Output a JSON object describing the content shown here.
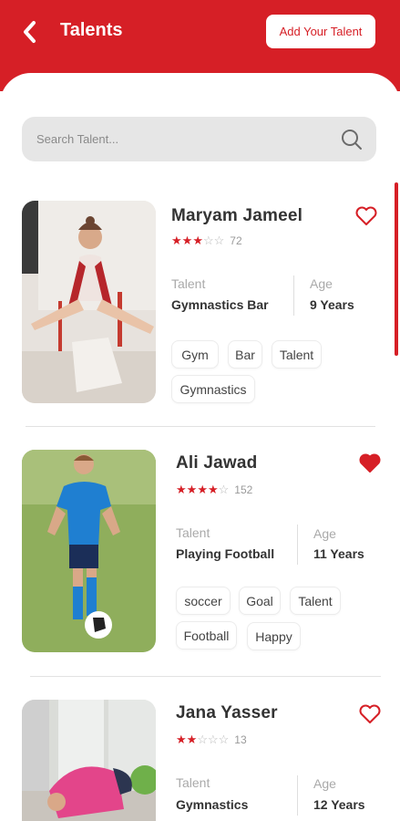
{
  "header": {
    "title": "Talents",
    "add_button": "Add Your Talent"
  },
  "search": {
    "placeholder": "Search Talent..."
  },
  "labels": {
    "talent": "Talent",
    "age": "Age"
  },
  "talents": [
    {
      "name": "Maryam Jameel",
      "rating": 3,
      "reviews": "72",
      "talent": "Gymnastics Bar",
      "age": "9 Years",
      "favorited": false,
      "tags": [
        "Gym",
        "Bar",
        "Talent",
        "Gymnastics"
      ]
    },
    {
      "name": "Ali Jawad",
      "rating": 4,
      "reviews": "152",
      "talent": "Playing Football",
      "age": "11 Years",
      "favorited": true,
      "tags": [
        "soccer",
        "Goal",
        "Talent",
        "Football",
        "Happy"
      ]
    },
    {
      "name": "Jana Yasser",
      "rating": 2,
      "reviews": "13",
      "talent": "Gymnastics",
      "age": "12 Years",
      "favorited": false,
      "tags": []
    }
  ],
  "colors": {
    "accent": "#d61f26",
    "search_bg": "#e6e6e6"
  }
}
